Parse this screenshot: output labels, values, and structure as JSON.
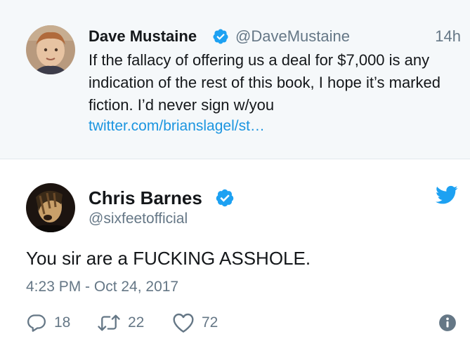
{
  "quoted_tweet": {
    "author_name": "Dave Mustaine",
    "handle": "@DaveMustaine",
    "time": "14h",
    "text": "If the fallacy of offering us a deal for $7,000 is any indication of the rest of this book, I hope it’s marked fiction. I’d never sign w/you",
    "link": "twitter.com/brianslagel/st…",
    "verified_icon": "verified-badge-icon",
    "avatar_icon": "avatar-image"
  },
  "tweet": {
    "author_name": "Chris Barnes",
    "handle": "@sixfeetofficial",
    "text": "You sir are a FUCKING ASSHOLE.",
    "date": "4:23 PM - Oct 24, 2017",
    "verified_icon": "verified-badge-icon",
    "logo_icon": "twitter-bird-icon",
    "actions": {
      "reply_count": "18",
      "retweet_count": "22",
      "like_count": "72"
    }
  },
  "colors": {
    "accent": "#1da1f2",
    "link": "#1b95e0",
    "muted": "#657786",
    "text": "#14171a",
    "quoted_bg": "#f5f8fa"
  }
}
